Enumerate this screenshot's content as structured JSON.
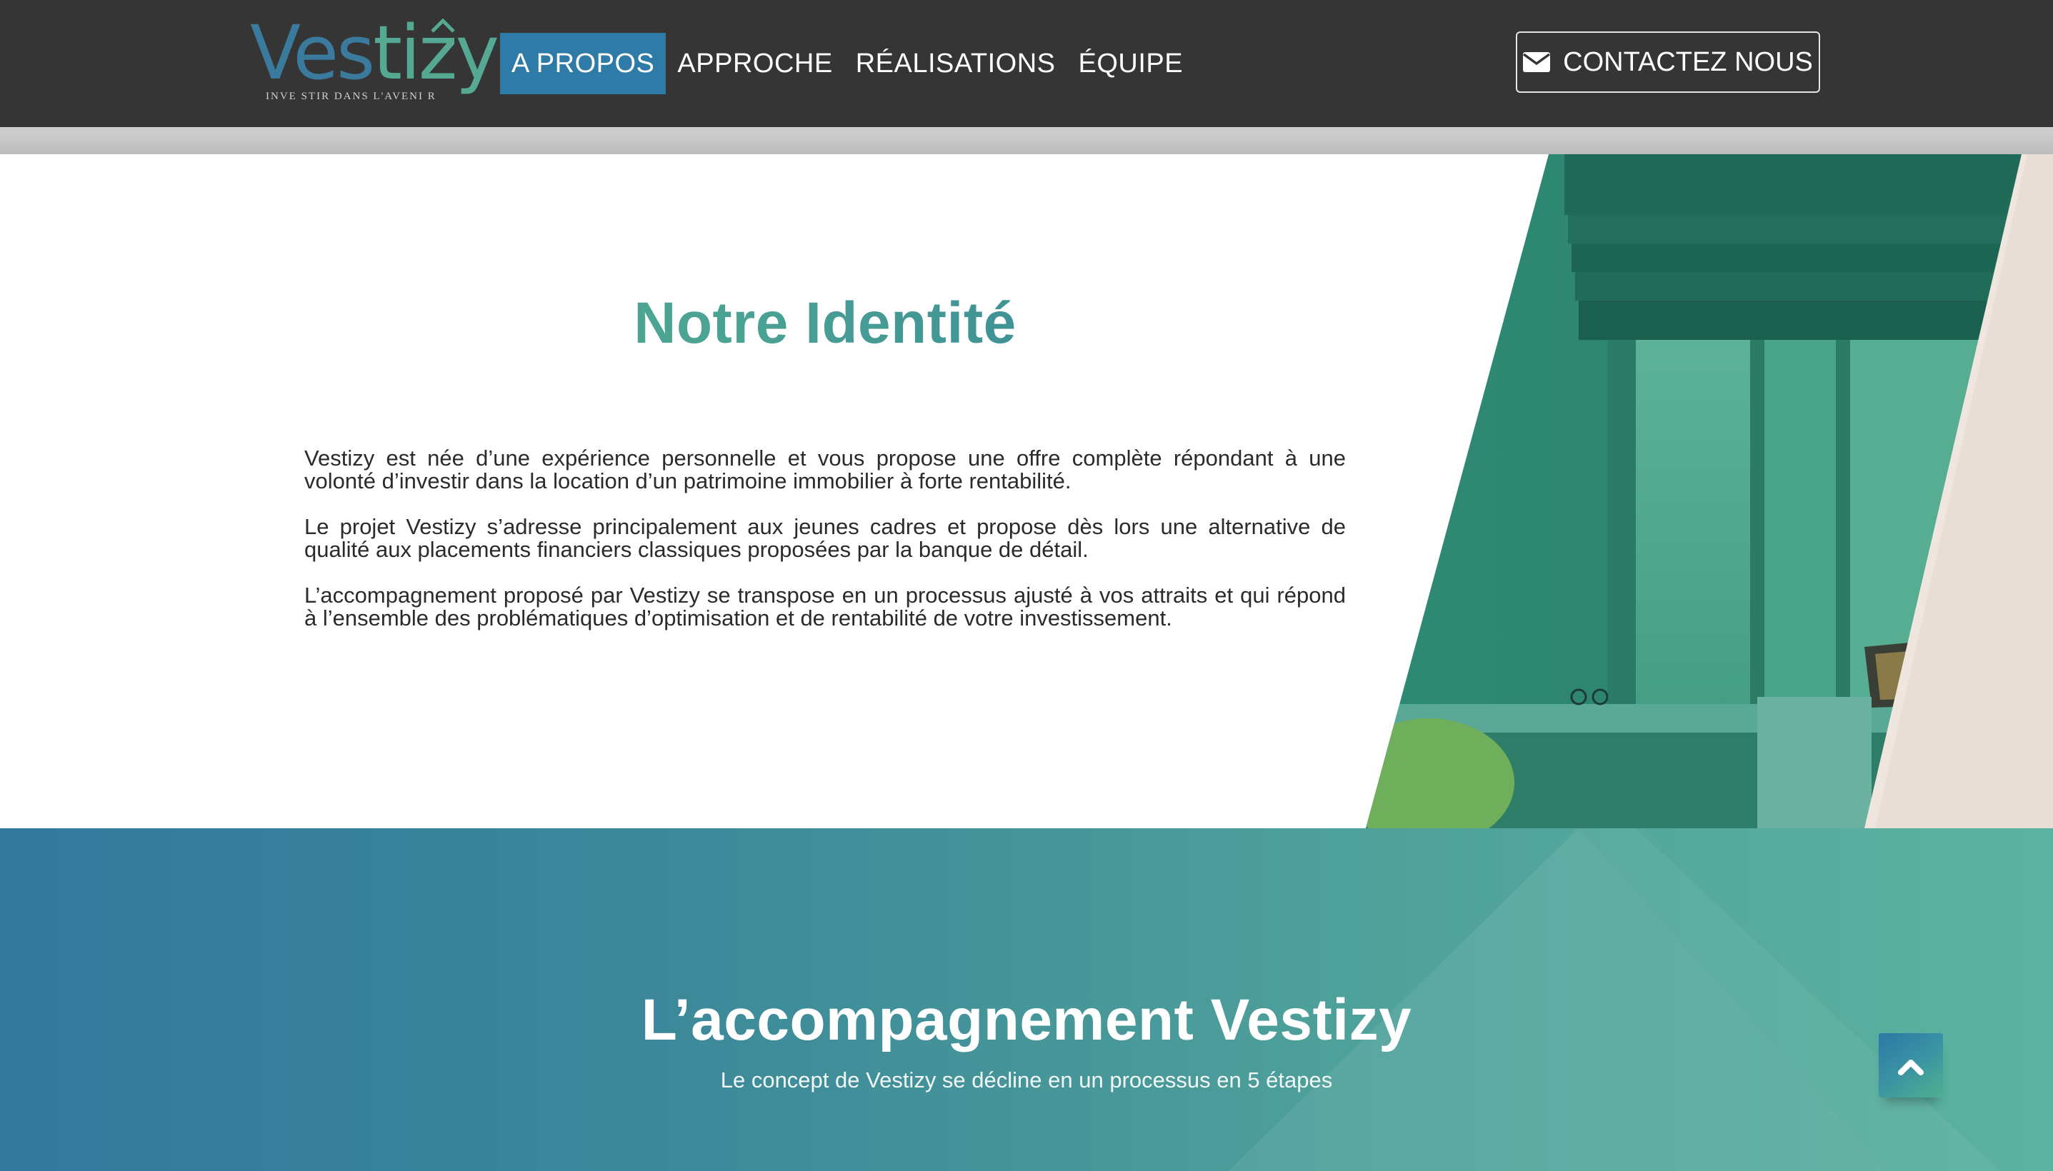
{
  "brand": {
    "name_part1": "Ves",
    "name_part2": "tizy",
    "tagline": "INVE STIR  DANS  L'AVENI R"
  },
  "nav": {
    "items": [
      {
        "label": "A PROPOS",
        "active": true
      },
      {
        "label": "APPROCHE",
        "active": false
      },
      {
        "label": "RÉALISATIONS",
        "active": false
      },
      {
        "label": "ÉQUIPE",
        "active": false
      }
    ],
    "contact_label": "CONTACTEZ NOUS",
    "contact_icon": "envelope-icon"
  },
  "identity": {
    "title": "Notre Identité",
    "paragraphs": [
      "Vestizy est née d’une expérience personnelle et vous propose une offre complète répondant à une volonté d’investir dans la location d’un patrimoine immobilier à forte rentabilité.",
      "Le projet Vestizy s’adresse principalement aux jeunes cadres et propose dès lors une alternative de qualité aux placements financiers classiques proposées par la banque de détail.",
      "L’accompagnement proposé par Vestizy se transpose en un processus ajusté à vos attraits et qui répond à l’ensemble des problématiques d’optimisation et de rentabilité de votre investissement."
    ]
  },
  "accompaniment": {
    "title": "L’accompagnement Vestizy",
    "subtitle": "Le concept de Vestizy se décline en un processus en 5 étapes"
  },
  "scroll_top": {
    "icon": "chevron-up-icon"
  },
  "colors": {
    "header_bg": "#353535",
    "nav_active": "#2e7ba7",
    "brand_blue": "#3a7a9c",
    "brand_green": "#55a892",
    "section_gradient_start": "#33789d",
    "section_gradient_end": "#5cb2a0"
  }
}
